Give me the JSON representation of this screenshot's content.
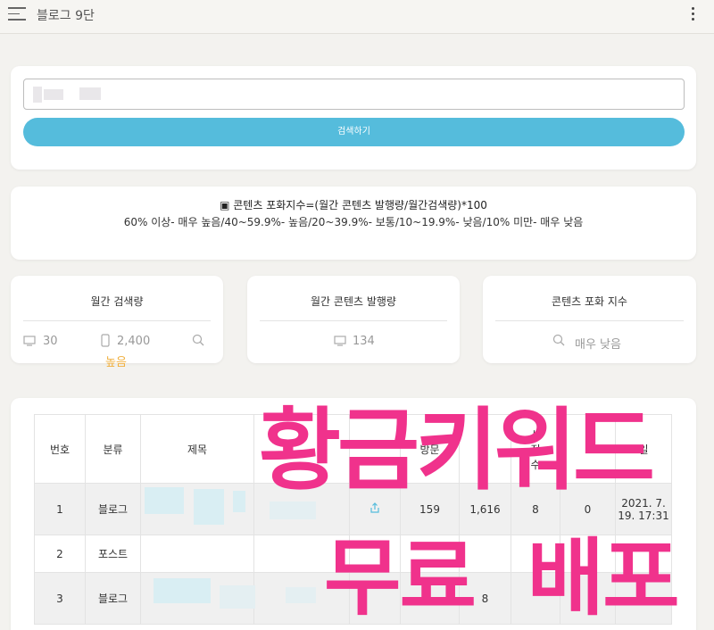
{
  "header": {
    "title": "블로그 9단"
  },
  "search": {
    "input_value": "",
    "button_label": "검색하기"
  },
  "info": {
    "formula": "▣ 콘텐츠 포화지수=(월간 콘텐츠 발행량/월간검색량)*100",
    "scale": "60% 이상- 매우 높음/40~59.9%- 높음/20~39.9%- 보통/10~19.9%- 낮음/10% 미만- 매우 낮음"
  },
  "stats": {
    "monthly_search": {
      "title": "월간 검색량",
      "pc": "30",
      "mobile": "2,400",
      "level": "높음"
    },
    "monthly_publish": {
      "title": "월간 콘텐츠 발행량",
      "pc": "134"
    },
    "saturation": {
      "title": "콘텐츠 포화 지수",
      "value": "매우 낮음"
    }
  },
  "table": {
    "headers": {
      "num": "번호",
      "category": "분류",
      "title": "제목",
      "views": "방문",
      "partial_1": "시\n정\n수",
      "date_partial": "일"
    },
    "rows": [
      {
        "num": "1",
        "category": "블로그",
        "c1": "159",
        "c2": "1,616",
        "c3": "8",
        "c4": "0",
        "date": "2021. 7. 19. 17:31"
      },
      {
        "num": "2",
        "category": "포스트"
      },
      {
        "num": "3",
        "category": "블로그",
        "c2_partial": "8"
      }
    ]
  },
  "overlay": {
    "line1": "황금키워드",
    "line2": "무료 배포"
  },
  "colors": {
    "accent": "#55bcdc",
    "overlay": "#f0328c",
    "level": "#f0b040"
  }
}
